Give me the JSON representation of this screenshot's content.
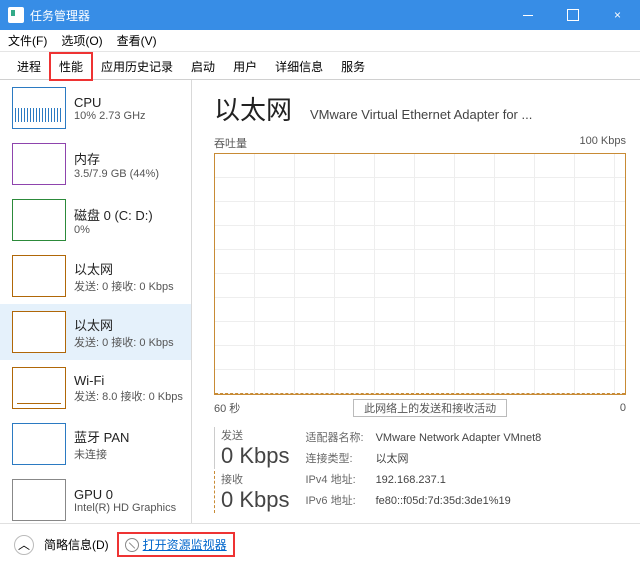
{
  "window": {
    "title": "任务管理器"
  },
  "menu": {
    "file": "文件(F)",
    "options": "选项(O)",
    "view": "查看(V)"
  },
  "tabs": [
    "进程",
    "性能",
    "应用历史记录",
    "启动",
    "用户",
    "详细信息",
    "服务"
  ],
  "sidebar": {
    "items": [
      {
        "name": "CPU",
        "sub": "10% 2.73 GHz"
      },
      {
        "name": "内存",
        "sub": "3.5/7.9 GB (44%)"
      },
      {
        "name": "磁盘 0 (C: D:)",
        "sub": "0%"
      },
      {
        "name": "以太网",
        "sub": "发送: 0 接收: 0 Kbps"
      },
      {
        "name": "以太网",
        "sub": "发送: 0 接收: 0 Kbps"
      },
      {
        "name": "Wi-Fi",
        "sub": "发送: 8.0 接收: 0 Kbps"
      },
      {
        "name": "蓝牙 PAN",
        "sub": "未连接"
      },
      {
        "name": "GPU 0",
        "sub": "Intel(R) HD Graphics"
      }
    ]
  },
  "main": {
    "title": "以太网",
    "adapter": "VMware Virtual Ethernet Adapter for ...",
    "chart": {
      "yLabelLeft": "吞吐量",
      "yLabelRight": "100 Kbps",
      "xLeft": "60 秒",
      "xRight": "0",
      "overlay": "此网络上的发送和接收活动"
    },
    "send": {
      "label": "发送",
      "value": "0 Kbps"
    },
    "recv": {
      "label": "接收",
      "value": "0 Kbps"
    },
    "details": {
      "adapterNameLabel": "适配器名称:",
      "adapterName": "VMware Network Adapter VMnet8",
      "connTypeLabel": "连接类型:",
      "connType": "以太网",
      "ipv4Label": "IPv4 地址:",
      "ipv4": "192.168.237.1",
      "ipv6Label": "IPv6 地址:",
      "ipv6": "fe80::f05d:7d:35d:3de1%19"
    }
  },
  "footer": {
    "less": "简略信息(D)",
    "resmon": "打开资源监视器"
  },
  "colors": {
    "accent": "#378de6",
    "net": "#b06708",
    "highlight": "#e33"
  },
  "chart_data": {
    "type": "line",
    "title": "吞吐量",
    "x": {
      "label": "秒",
      "range": [
        60,
        0
      ]
    },
    "y": {
      "label": "Kbps",
      "range": [
        0,
        100
      ]
    },
    "series": [
      {
        "name": "发送",
        "values": [
          0,
          0,
          0,
          0,
          0,
          0,
          0,
          0,
          0,
          0,
          0,
          0,
          0,
          0,
          0,
          0,
          0,
          0,
          0,
          0
        ]
      },
      {
        "name": "接收",
        "values": [
          0,
          0,
          0,
          0,
          0,
          0,
          0,
          0,
          0,
          0,
          0,
          0,
          0,
          0,
          0,
          0,
          0,
          0,
          0,
          0
        ]
      }
    ]
  }
}
